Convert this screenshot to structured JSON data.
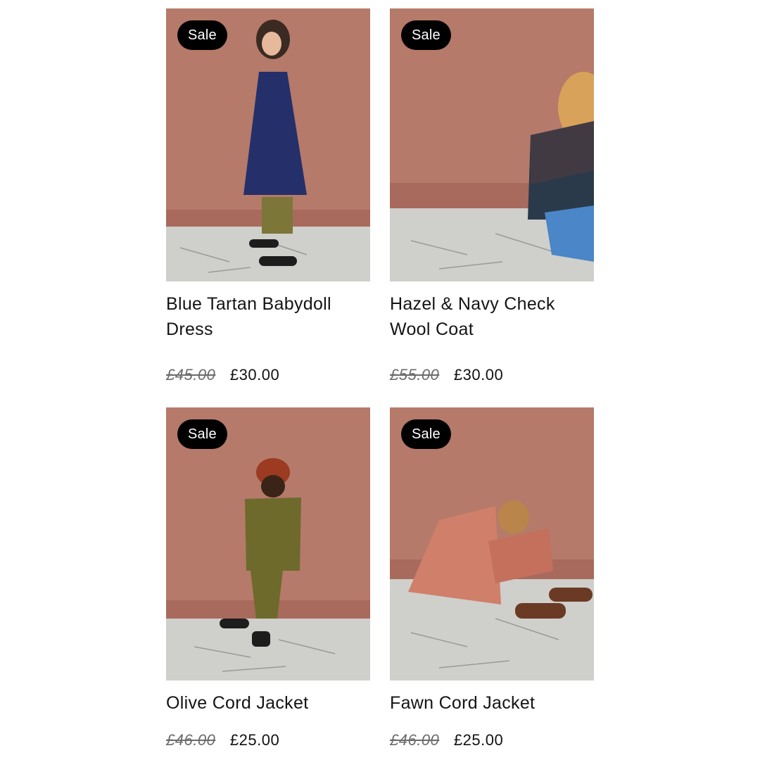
{
  "products": [
    {
      "badge": "Sale",
      "title": "Blue Tartan Babydoll Dress",
      "original_price": "£45.00",
      "sale_price": "£30.00",
      "image": "child-in-navy-tartan-dress"
    },
    {
      "badge": "Sale",
      "title": "Hazel & Navy Check Wool Coat",
      "original_price": "£55.00",
      "sale_price": "£30.00",
      "image": "child-in-check-wool-coat"
    },
    {
      "badge": "Sale",
      "title": "Olive Cord Jacket",
      "original_price": "£46.00",
      "sale_price": "£25.00",
      "image": "child-in-olive-cord-jacket"
    },
    {
      "badge": "Sale",
      "title": "Fawn Cord Jacket",
      "original_price": "£46.00",
      "sale_price": "£25.00",
      "image": "child-in-fawn-cord-jacket"
    }
  ],
  "colors": {
    "backdrop": "#b57a6a",
    "floor": "#cfcfcb",
    "badge_bg": "#000000",
    "badge_text": "#ffffff",
    "old_price": "#6b6b6b"
  }
}
